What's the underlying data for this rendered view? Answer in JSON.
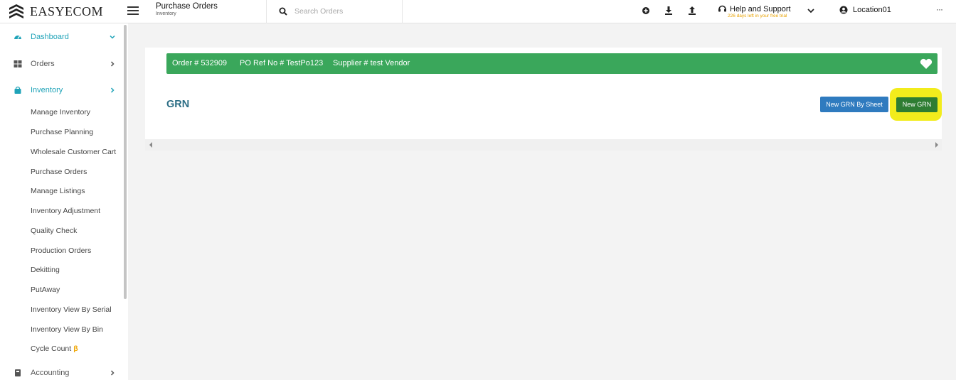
{
  "header": {
    "logo_text": "EASYECOM",
    "page_title": "Purchase Orders",
    "page_subtitle": "Inventory",
    "search_placeholder": "Search Orders",
    "help_label": "Help and Support",
    "trial_text": "226 days left in your free trial",
    "location_label": "Location01",
    "more_label": "···"
  },
  "sidebar": {
    "main_items": [
      {
        "label": "Dashboard",
        "icon": "dashboard-icon",
        "active": true
      },
      {
        "label": "Orders",
        "icon": "grid-icon"
      },
      {
        "label": "Inventory",
        "icon": "bag-icon",
        "active": true
      },
      {
        "label": "Accounting",
        "icon": "ledger-icon"
      }
    ],
    "inventory_sub_items": [
      "Manage Inventory",
      "Purchase Planning",
      "Wholesale Customer Cart",
      "Purchase Orders",
      "Manage Listings",
      "Inventory Adjustment",
      "Quality Check",
      "Production Orders",
      "Dekitting",
      "PutAway",
      "Inventory View By Serial",
      "Inventory View By Bin",
      "Cycle Count"
    ],
    "beta_mark": "β"
  },
  "order_bar": {
    "order": "Order # 532909",
    "po_ref": "PO Ref No # TestPo123",
    "supplier": "Supplier # test Vendor"
  },
  "grn": {
    "title": "GRN",
    "new_by_sheet_label": "New GRN By Sheet",
    "new_label": "New GRN"
  },
  "colors": {
    "accent_teal": "#1fa3b8",
    "order_bar_green": "#3aa75b",
    "sheet_button_blue": "#2f7bbf",
    "new_button_green": "#2e7d32",
    "highlight_yellow": "#f2ec1c",
    "trial_orange": "#e8a200"
  }
}
